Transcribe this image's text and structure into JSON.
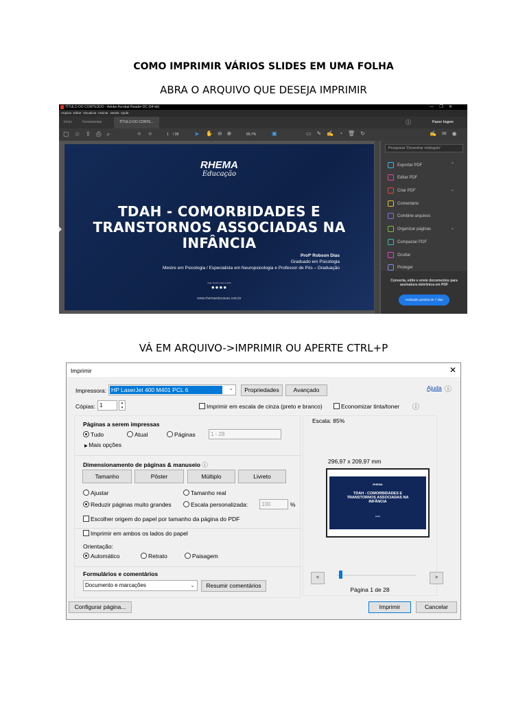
{
  "headings": {
    "h1": "COMO IMPRIMIR VÁRIOS SLIDES EM UMA FOLHA",
    "h2": "ABRA O ARQUIVO QUE DESEJA IMPRIMIR",
    "h3": "VÁ EM ARQUIVO->IMPRIMIR OU APERTE CTRL+P"
  },
  "acrobat": {
    "title": "TÍTULO DO CONTEÚDO - Adobe Acrobat Reader DC (64-bit)",
    "menu": [
      "Arquivo",
      "Editar",
      "Visualizar",
      "Assinar",
      "Janela",
      "Ajuda"
    ],
    "tabs": [
      "Início",
      "Ferramentas",
      "TÍTULO DO CONTE..."
    ],
    "login": "Fazer logon",
    "page": "1",
    "page_total": "/ 28",
    "zoom": "69,7%",
    "slide": {
      "logo1": "RHEMA",
      "logo2": "Educação",
      "title": [
        "TDAH - COMORBIDADES E",
        "TRANSTORNOS ASSOCIADAS NA",
        "INFÂNCIA"
      ],
      "prof": "Profª Robson Dias",
      "line2": "Graduado em Psicologia",
      "line3": "Mestre em Psicologia / Especialista em Neuropsicologia e Professor de Pós – Graduação",
      "social": "Siga nossas redes sociais",
      "site": "www.rhemaeducacao.com.br"
    },
    "panel": {
      "search": "Pesquisar 'Desenhar retângulo'",
      "items": [
        {
          "label": "Exportar PDF",
          "color": "#3fb5e8"
        },
        {
          "label": "Editar PDF",
          "color": "#e8459a"
        },
        {
          "label": "Criar PDF",
          "color": "#e84545"
        },
        {
          "label": "Comentário",
          "color": "#e8c53f"
        },
        {
          "label": "Combine arquivos",
          "color": "#8a6fe8"
        },
        {
          "label": "Organizar páginas",
          "color": "#7ec23f"
        },
        {
          "label": "Compactar PDF",
          "color": "#3fc2b5"
        },
        {
          "label": "Ocultar",
          "color": "#e845c8"
        },
        {
          "label": "Proteger",
          "color": "#8a8ae8"
        }
      ],
      "promo": "Converta, edite e envie documentos para assinatura eletrônica em PDF",
      "trial": "Avaliação gratuita de 7 dias"
    }
  },
  "dialog": {
    "title": "Imprimir",
    "printer_label": "Impressora:",
    "printer": "HP LaserJet 400 M401 PCL 6",
    "properties": "Propriedades",
    "advanced": "Avançado",
    "help": "Ajuda",
    "copies_label": "Cópias:",
    "copies": "1",
    "grayscale": "Imprimir em escala de cinza (preto e branco)",
    "save_ink": "Economizar tinta/toner",
    "pages_title": "Páginas a serem impressas",
    "all": "Tudo",
    "current": "Atual",
    "pages": "Páginas",
    "pages_range": "1 - 28",
    "more": "Mais opções",
    "sizing_title": "Dimensionamento de páginas & manuseio",
    "tabs": [
      "Tamanho",
      "Pôster",
      "Múltiplo",
      "Livreto"
    ],
    "fit": "Ajustar",
    "actual": "Tamanho real",
    "shrink": "Reduzir páginas muito grandes",
    "custom": "Escala personalizada:",
    "custom_value": "100",
    "percent": "%",
    "paper_source": "Escolher origem do papel por tamanho da página do PDF",
    "duplex": "Imprimir em ambos os lados do papel",
    "orientation": "Orientação:",
    "auto": "Automático",
    "portrait": "Retrato",
    "landscape": "Paisagem",
    "forms_title": "Formulários e comentários",
    "forms_value": "Documento e marcações",
    "summarize": "Resumir comentários",
    "scale": "Escala:  85%",
    "dims": "296,97 x 209,97 mm",
    "prev": "<",
    "next": ">",
    "page_of": "Página 1 de 28",
    "setup": "Configurar página...",
    "print": "Imprimir",
    "cancel": "Cancelar",
    "preview": {
      "t": [
        "TDAH - COMORBIDADES E",
        "TRANSTORNOS ASSOCIADAS NA",
        "INFÂNCIA"
      ],
      "logo": "RHEMA"
    }
  }
}
